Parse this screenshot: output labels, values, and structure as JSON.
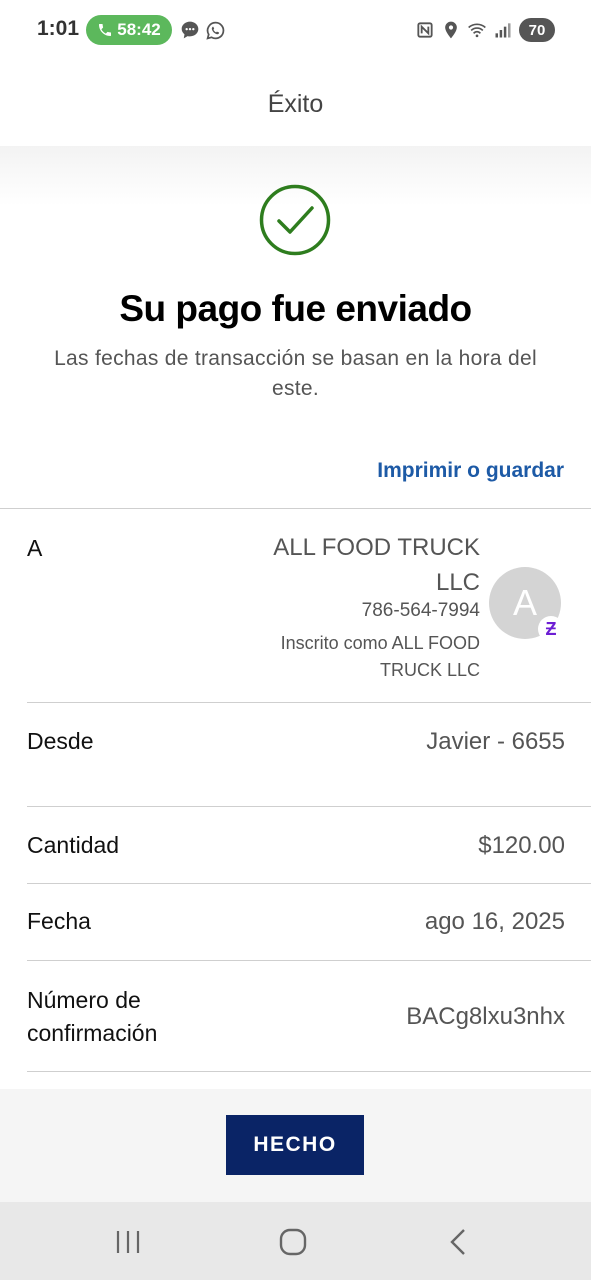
{
  "status_bar": {
    "time": "1:01",
    "call_timer": "58:42",
    "battery": "70",
    "icons": [
      "phone-icon",
      "message-icon",
      "whatsapp-icon",
      "nfc-icon",
      "location-icon",
      "wifi-icon",
      "signal-icon",
      "battery-icon"
    ]
  },
  "header": {
    "title": "Éxito"
  },
  "success": {
    "icon": "checkmark-circle-icon",
    "title": "Su pago fue enviado",
    "subtitle": "Las fechas de transacción se basan en la hora del este.",
    "print_link": "Imprimir o guardar"
  },
  "details": {
    "to_label": "A",
    "recipient_name": "ALL FOOD TRUCK LLC",
    "recipient_phone": "786-564-7994",
    "recipient_enrolled": "Inscrito como ALL FOOD TRUCK LLC",
    "avatar_letter": "A",
    "badge_icon": "zelle-icon",
    "badge_glyph": "Ƶ",
    "from_label": "Desde",
    "from_value": "Javier - 6655",
    "amount_label": "Cantidad",
    "amount_value": "$120.00",
    "date_label": "Fecha",
    "date_value": "ago 16, 2025",
    "confirmation_label": "Número de confirmación",
    "confirmation_value": "BACg8lxu3nhx"
  },
  "footer": {
    "done_label": "HECHO"
  },
  "nav_bar": {
    "icons": [
      "recent-apps-icon",
      "home-icon",
      "back-icon"
    ]
  },
  "colors": {
    "accent_link": "#1d5aa6",
    "success_green": "#2e7d1e",
    "button_navy": "#0a2466",
    "zelle_purple": "#6d1ed4"
  }
}
